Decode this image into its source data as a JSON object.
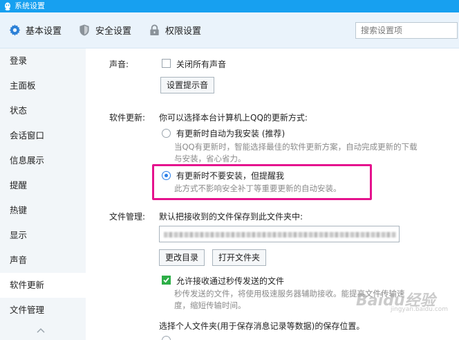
{
  "window": {
    "title": "系统设置"
  },
  "tabs": [
    {
      "label": "基本设置",
      "icon": "gear-icon"
    },
    {
      "label": "安全设置",
      "icon": "shield-icon"
    },
    {
      "label": "权限设置",
      "icon": "lock-icon"
    }
  ],
  "search": {
    "placeholder": "搜索设置项"
  },
  "sidebar": {
    "items": [
      {
        "label": "登录"
      },
      {
        "label": "主面板"
      },
      {
        "label": "状态"
      },
      {
        "label": "会话窗口"
      },
      {
        "label": "信息展示"
      },
      {
        "label": "提醒"
      },
      {
        "label": "热键"
      },
      {
        "label": "显示"
      },
      {
        "label": "声音"
      },
      {
        "label": "软件更新"
      },
      {
        "label": "文件管理"
      }
    ],
    "active_index": 9
  },
  "sound": {
    "label": "声音:",
    "mute_all_label": "关闭所有声音",
    "mute_all_checked": false,
    "set_sound_button": "设置提示音"
  },
  "update": {
    "label": "软件更新:",
    "intro": "你可以选择本台计算机上QQ的更新方式:",
    "option_auto_label": "有更新时自动为我安装 (推荐)",
    "option_auto_desc_1": "当QQ有更新时，智能选择最佳的软件更新方案，自动完成更新的下载",
    "option_auto_desc_2": "与安装，省心省力。",
    "option_notify_label": "有更新时不要安装，但提醒我",
    "option_notify_desc": "此方式不影响安全补丁等重要更新的自动安装。",
    "selected": "notify"
  },
  "files": {
    "label": "文件管理:",
    "intro": "默认把接收到的文件保存到此文件夹中:",
    "change_dir_button": "更改目录",
    "open_folder_button": "打开文件夹",
    "allow_fast_label": "允许接收通过秒传发送的文件",
    "allow_fast_checked": true,
    "allow_fast_desc_1": "秒传发送的文件，将使用极速服务器辅助接收。能提高文件传输速",
    "allow_fast_desc_2": "度，缩短传输时间。",
    "personal_folder_label": "选择个人文件夹(用于保存消息记录等数据)的保存位置。"
  },
  "watermark": {
    "brand": "Baidu经验",
    "url": "jingyan.baidu.com"
  },
  "colors": {
    "titlebar": "#17a0f0",
    "highlight": "#e5128d",
    "check_green": "#2dae47",
    "radio_blue": "#2b7fe8"
  }
}
